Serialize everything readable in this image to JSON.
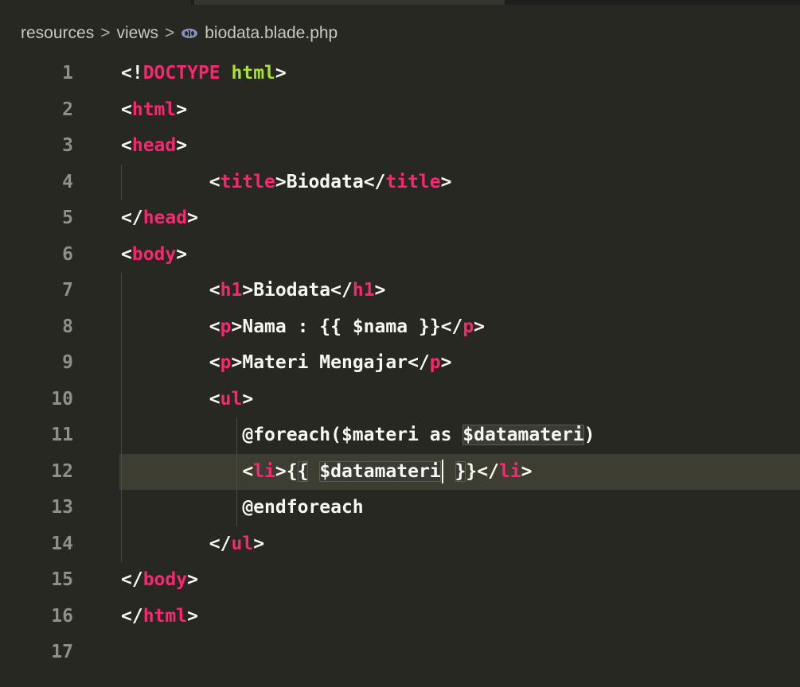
{
  "breadcrumb": {
    "part1": "resources",
    "part2": "views",
    "file": "biodata.blade.php",
    "separator": ">",
    "file_icon": "blade-file-icon"
  },
  "lines": [
    {
      "num": "1"
    },
    {
      "num": "2"
    },
    {
      "num": "3"
    },
    {
      "num": "4"
    },
    {
      "num": "5"
    },
    {
      "num": "6"
    },
    {
      "num": "7"
    },
    {
      "num": "8"
    },
    {
      "num": "9"
    },
    {
      "num": "10"
    },
    {
      "num": "11"
    },
    {
      "num": "12"
    },
    {
      "num": "13"
    },
    {
      "num": "14"
    },
    {
      "num": "15"
    },
    {
      "num": "16"
    },
    {
      "num": "17"
    }
  ],
  "code": {
    "l1": {
      "open": "<!",
      "doctype": "DOCTYPE",
      "space": " ",
      "html": "html",
      "close": ">"
    },
    "l2": {
      "open": "<",
      "tag": "html",
      "close": ">"
    },
    "l3": {
      "open": "<",
      "tag": "head",
      "close": ">"
    },
    "l4": {
      "indent": "        ",
      "open1": "<",
      "tag1": "title",
      "close1": ">",
      "text": "Biodata",
      "open2": "</",
      "tag2": "title",
      "close2": ">"
    },
    "l5": {
      "open": "</",
      "tag": "head",
      "close": ">"
    },
    "l6": {
      "open": "<",
      "tag": "body",
      "close": ">"
    },
    "l7": {
      "indent": "        ",
      "open1": "<",
      "tag1": "h1",
      "close1": ">",
      "text": "Biodata",
      "open2": "</",
      "tag2": "h1",
      "close2": ">"
    },
    "l8": {
      "indent": "        ",
      "open1": "<",
      "tag1": "p",
      "close1": ">",
      "text": "Nama : {{ $nama }}",
      "open2": "</",
      "tag2": "p",
      "close2": ">"
    },
    "l9": {
      "indent": "        ",
      "open1": "<",
      "tag1": "p",
      "close1": ">",
      "text": "Materi Mengajar",
      "open2": "</",
      "tag2": "p",
      "close2": ">"
    },
    "l10": {
      "indent": "        ",
      "open": "<",
      "tag": "ul",
      "close": ">"
    },
    "l11": {
      "indent": "           ",
      "text_a": "@foreach($materi as ",
      "text_b": "$datamateri",
      "text_c": ")"
    },
    "l12": {
      "indent": "           ",
      "open1": "<",
      "tag1": "li",
      "close1": ">",
      "brace1": "{",
      "brace2": "{",
      "text_a": " ",
      "text_b": "$datamateri",
      "brace3": "}",
      "brace4": "}",
      "open2": "</",
      "tag2": "li",
      "close2": ">"
    },
    "l13": {
      "indent": "           ",
      "text": "@endforeach"
    },
    "l14": {
      "indent": "        ",
      "open": "</",
      "tag": "ul",
      "close": ">"
    },
    "l15": {
      "open": "</",
      "tag": "body",
      "close": ">"
    },
    "l16": {
      "open": "</",
      "tag": "html",
      "close": ">"
    }
  },
  "colors": {
    "background": "#272822",
    "tag": "#f92672",
    "doctype_name": "#a6e22e",
    "text": "#f8f8f2",
    "line_number": "#90908a",
    "current_line": "#3e3d32"
  }
}
